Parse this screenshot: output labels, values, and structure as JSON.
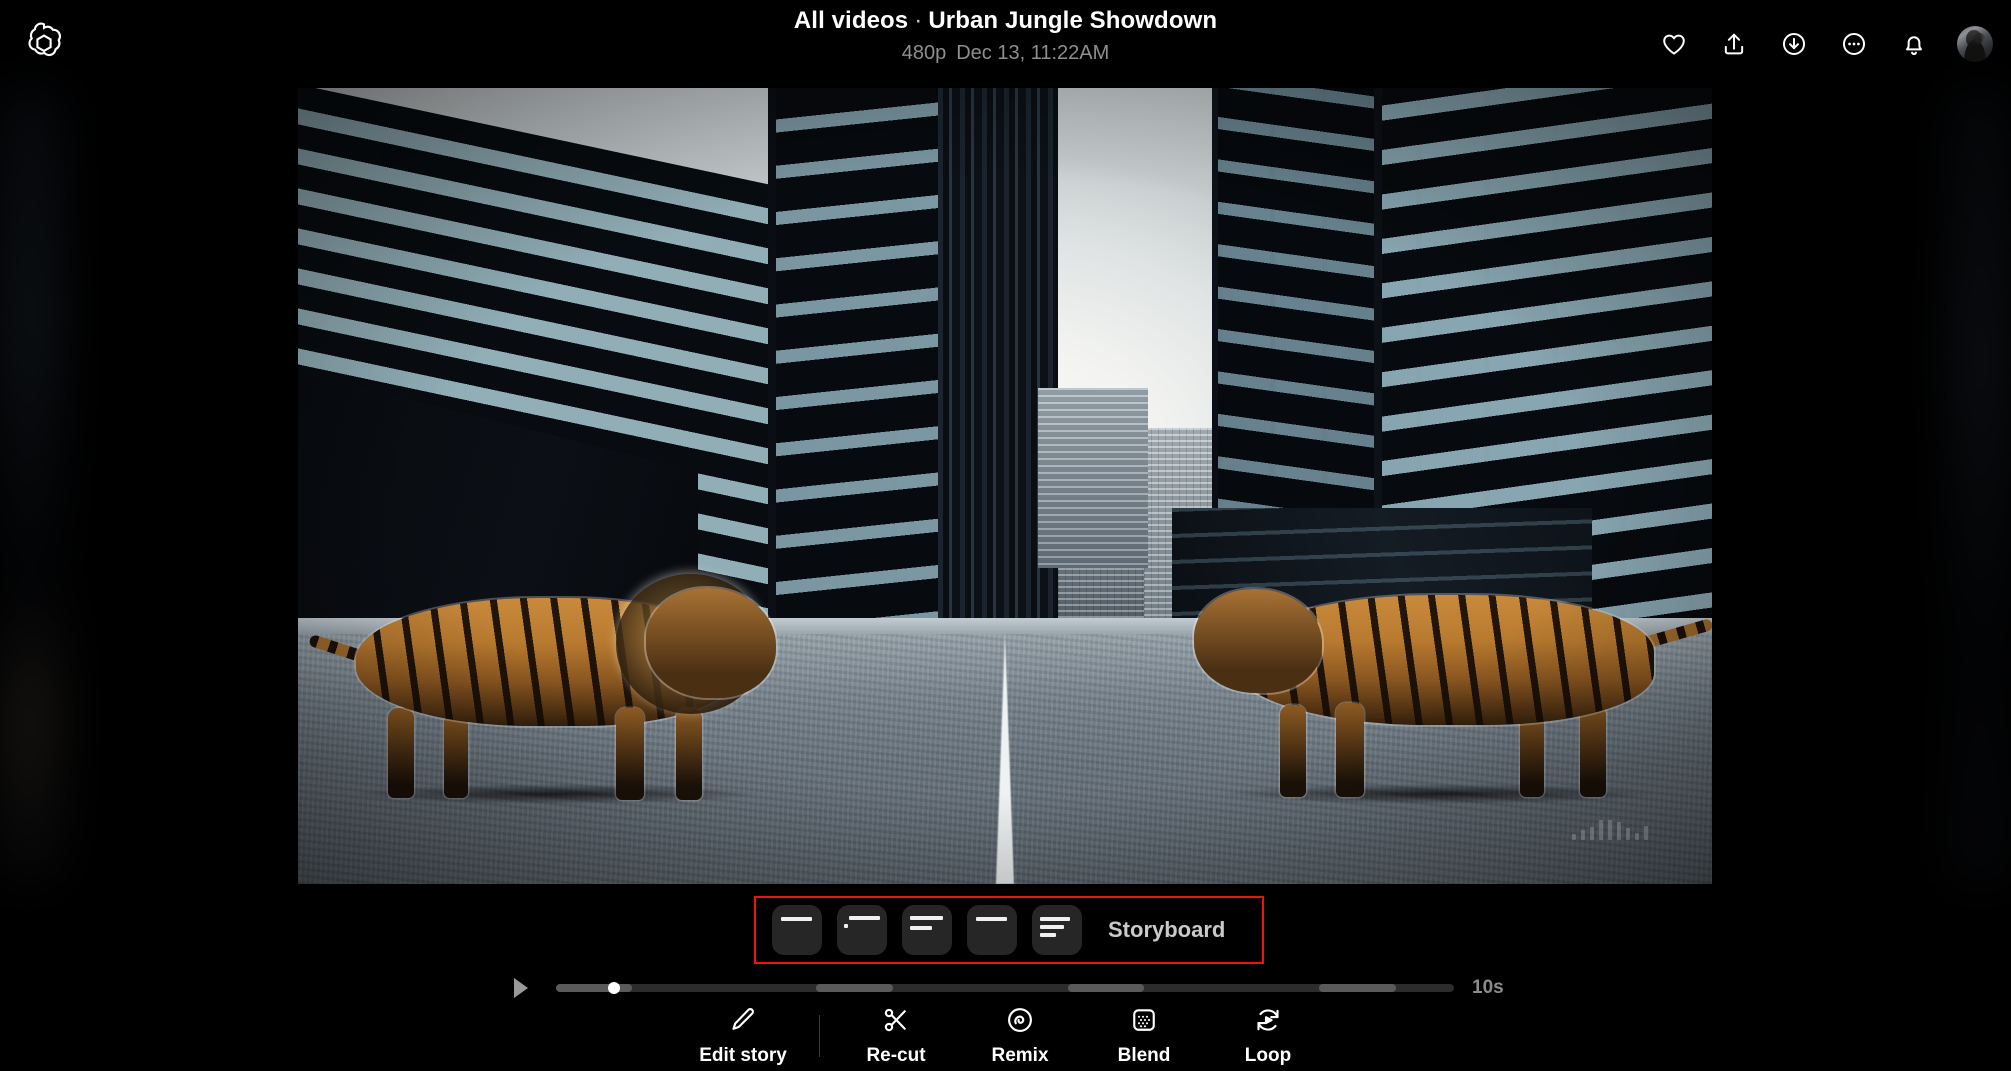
{
  "app": {
    "brand_icon": "openai-logo"
  },
  "header": {
    "breadcrumb_root": "All videos",
    "separator": "·",
    "video_title": "Urban Jungle Showdown",
    "resolution": "480p",
    "timestamp": "Dec 13, 11:22AM",
    "actions": [
      {
        "name": "favorite",
        "icon": "heart-icon",
        "label": "Favorite"
      },
      {
        "name": "share",
        "icon": "share-upload-icon",
        "label": "Share"
      },
      {
        "name": "download",
        "icon": "download-circle-icon",
        "label": "Download"
      },
      {
        "name": "more",
        "icon": "more-options-icon",
        "label": "More"
      },
      {
        "name": "notifications",
        "icon": "bell-icon",
        "label": "Notifications"
      },
      {
        "name": "account",
        "icon": "avatar",
        "label": "Account"
      }
    ]
  },
  "video": {
    "scene_description": "Two tigers facing each other on a city street between skyscrapers",
    "watermark": "sora-watermark"
  },
  "storyboard": {
    "label": "Storyboard",
    "highlighted": true,
    "highlight_color": "#ef1212",
    "cards": [
      {
        "id": 1,
        "lines": 1
      },
      {
        "id": 2,
        "lines": 1
      },
      {
        "id": 3,
        "lines": 2
      },
      {
        "id": 4,
        "lines": 1
      },
      {
        "id": 5,
        "lines": 3
      }
    ]
  },
  "player": {
    "play_icon": "play-icon",
    "duration_label": "10s",
    "playhead_percent": 5.8,
    "segments": [
      {
        "start": 0,
        "width": 8.5
      },
      {
        "start": 29,
        "width": 8.5
      },
      {
        "start": 57,
        "width": 8.5
      },
      {
        "start": 85,
        "width": 8.5
      }
    ]
  },
  "toolbar": {
    "items": [
      {
        "name": "edit-story",
        "label": "Edit story",
        "icon": "pencil-icon"
      },
      {
        "name": "re-cut",
        "label": "Re-cut",
        "icon": "scissors-icon"
      },
      {
        "name": "remix",
        "label": "Remix",
        "icon": "spiral-icon"
      },
      {
        "name": "blend",
        "label": "Blend",
        "icon": "blend-icon"
      },
      {
        "name": "loop",
        "label": "Loop",
        "icon": "loop-icon"
      }
    ]
  },
  "colors": {
    "background": "#000000",
    "highlight": "#ef1212",
    "text_primary": "#ffffff",
    "text_muted": "#8f8f8f",
    "card": "#262626"
  }
}
